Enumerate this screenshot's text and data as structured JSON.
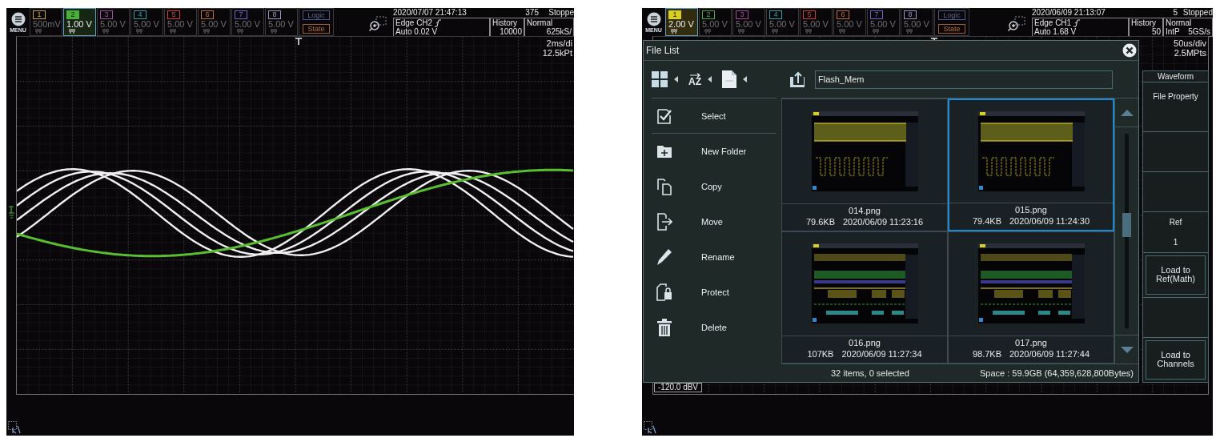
{
  "screens": [
    {
      "kind": "waveform",
      "menu_label": "MENU",
      "channels": [
        {
          "number": "1",
          "value": "500mV",
          "color": "#c8a838",
          "selected": false
        },
        {
          "number": "2",
          "value": "1.00 V",
          "color": "#48b038",
          "selected": true
        },
        {
          "number": "3",
          "value": "5.00 V",
          "color": "#a050a0",
          "selected": false
        },
        {
          "number": "4",
          "value": "5.00 V",
          "color": "#30a0a8",
          "selected": false
        },
        {
          "number": "5",
          "value": "5.00 V",
          "color": "#d04040",
          "selected": false
        },
        {
          "number": "6",
          "value": "5.00 V",
          "color": "#c07030",
          "selected": false
        },
        {
          "number": "7",
          "value": "5.00 V",
          "color": "#6868c8",
          "selected": false
        },
        {
          "number": "8",
          "value": "5.00 V",
          "color": "#9898c8",
          "selected": false
        }
      ],
      "logic_label": "Logic",
      "state_label": "State",
      "datetime": "2020/07/07 21:47:13",
      "count": "375",
      "run_state": "Stoppe",
      "trigger_source": "Edge CH2",
      "trigger_level": "Auto 0.02 V",
      "history_label": "History",
      "history_value": "10000",
      "acq_mode": "Normal",
      "sample_rate": "625kS/",
      "timebase": "2ms/di",
      "record_length": "12.5kPt"
    },
    {
      "kind": "file_list",
      "menu_label": "MENU",
      "channels": [
        {
          "number": "1",
          "value": "2.00 V",
          "color": "#d8d020",
          "selected": true
        },
        {
          "number": "2",
          "value": "5.00 V",
          "color": "#48b038",
          "selected": false
        },
        {
          "number": "3",
          "value": "5.00 V",
          "color": "#a050a0",
          "selected": false
        },
        {
          "number": "4",
          "value": "5.00 V",
          "color": "#30a0a8",
          "selected": false
        },
        {
          "number": "5",
          "value": "5.00 V",
          "color": "#d04040",
          "selected": false
        },
        {
          "number": "6",
          "value": "5.00 V",
          "color": "#c07030",
          "selected": false
        },
        {
          "number": "7",
          "value": "5.00 V",
          "color": "#6868c8",
          "selected": false
        },
        {
          "number": "8",
          "value": "5.00 V",
          "color": "#9898c8",
          "selected": false
        }
      ],
      "logic_label": "Logic",
      "state_label": "State",
      "datetime": "2020/06/09 21:13:07",
      "count": "5",
      "run_state": "Stopped",
      "trigger_source": "Edge CH1",
      "trigger_level": "Auto 1.68 V",
      "history_label": "History",
      "history_value": "50",
      "acq_mode": "Normal",
      "interpolation": "IntP",
      "sample_rate": "5GS/s",
      "timebase": "50us/div",
      "record_length": "2.5MPts",
      "scale_label": "-120.0 dBV",
      "file_list": {
        "title": "File List",
        "sort_label": "AZ",
        "path": "Flash_Mem",
        "menu": [
          {
            "label": "Select",
            "kind": "select"
          },
          {
            "label": "New Folder",
            "kind": "new_folder"
          },
          {
            "label": "Copy",
            "kind": "copy"
          },
          {
            "label": "Move",
            "kind": "move"
          },
          {
            "label": "Rename",
            "kind": "rename"
          },
          {
            "label": "Protect",
            "kind": "protect"
          },
          {
            "label": "Delete",
            "kind": "delete"
          }
        ],
        "files": [
          {
            "name": "014.png",
            "size": "79.6KB",
            "date": "2020/06/09 11:23:16",
            "selected": false,
            "kind": "square"
          },
          {
            "name": "015.png",
            "size": "79.4KB",
            "date": "2020/06/09 11:24:30",
            "selected": true,
            "kind": "square"
          },
          {
            "name": "016.png",
            "size": "107KB",
            "date": "2020/06/09 11:27:34",
            "selected": false,
            "kind": "bus"
          },
          {
            "name": "017.png",
            "size": "98.7KB",
            "date": "2020/06/09 11:27:44",
            "selected": false,
            "kind": "bus"
          }
        ],
        "status": "32 items, 0 selected",
        "space": "Space : 59.9GB (64,359,628,800Bytes)"
      },
      "side_panel": {
        "title": "Waveform",
        "items": [
          {
            "kind": "label",
            "text": "File Property"
          },
          {
            "kind": "blank"
          },
          {
            "kind": "blank"
          },
          {
            "kind": "value",
            "label": "Ref",
            "value": "1"
          },
          {
            "kind": "button",
            "text": "Load to Ref(Math)"
          },
          {
            "kind": "blank"
          },
          {
            "kind": "button",
            "text": "Load to Channels"
          }
        ]
      }
    }
  ]
}
